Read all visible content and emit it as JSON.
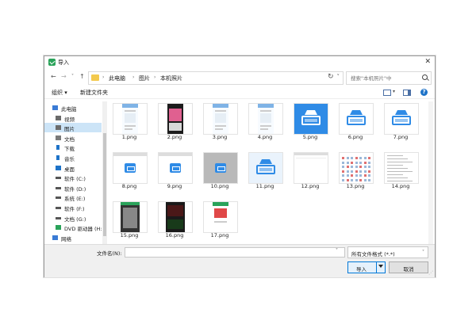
{
  "dialog": {
    "title": "导入",
    "close_glyph": "✕"
  },
  "nav": {
    "back_glyph": "←",
    "forward_glyph": "→",
    "recent_glyph": "˅",
    "up_glyph": "↑",
    "breadcrumb": [
      "此电脑",
      "图片",
      "本机照片"
    ],
    "crumb_sep": "›",
    "address_dropdown_glyph": "˅",
    "refresh_glyph": "↻",
    "search_placeholder": "搜索\"本机照片\"中"
  },
  "toolbar": {
    "organize_label": "组织 ▾",
    "new_folder_label": "新建文件夹",
    "view_dropdown_glyph": "▾",
    "help_glyph": "?"
  },
  "sidebar": {
    "items": [
      {
        "label": "此电脑",
        "icon": "pc-icon",
        "selected": false
      },
      {
        "label": "视频",
        "icon": "video-icon",
        "selected": false
      },
      {
        "label": "图片",
        "icon": "pictures-icon",
        "selected": true
      },
      {
        "label": "文档",
        "icon": "document-icon",
        "selected": false
      },
      {
        "label": "下载",
        "icon": "download-icon",
        "selected": false
      },
      {
        "label": "音乐",
        "icon": "music-icon",
        "selected": false
      },
      {
        "label": "桌面",
        "icon": "desktop-icon",
        "selected": false
      },
      {
        "label": "软件 (C:)",
        "icon": "drive-icon",
        "selected": false
      },
      {
        "label": "软件 (D:)",
        "icon": "drive-icon",
        "selected": false
      },
      {
        "label": "系统 (E:)",
        "icon": "drive-icon",
        "selected": false
      },
      {
        "label": "软件 (F:)",
        "icon": "drive-icon",
        "selected": false
      },
      {
        "label": "文档 (G:)",
        "icon": "drive-icon",
        "selected": false
      },
      {
        "label": "DVD 驱动器 (H:)",
        "icon": "dvd-icon",
        "selected": false
      },
      {
        "label": "网络",
        "icon": "network-icon",
        "selected": false
      }
    ]
  },
  "files": [
    {
      "name": "1.png",
      "kind": "phone-app"
    },
    {
      "name": "2.png",
      "kind": "phone-photo"
    },
    {
      "name": "3.png",
      "kind": "phone-app"
    },
    {
      "name": "4.png",
      "kind": "phone-app"
    },
    {
      "name": "5.png",
      "kind": "scanner-blue"
    },
    {
      "name": "6.png",
      "kind": "scanner-white"
    },
    {
      "name": "7.png",
      "kind": "scanner-white"
    },
    {
      "name": "8.png",
      "kind": "window-scanner"
    },
    {
      "name": "9.png",
      "kind": "window-scanner"
    },
    {
      "name": "10.png",
      "kind": "gray-scanner"
    },
    {
      "name": "11.png",
      "kind": "scanner-wide"
    },
    {
      "name": "12.png",
      "kind": "blank-doc"
    },
    {
      "name": "13.png",
      "kind": "grid-doc"
    },
    {
      "name": "14.png",
      "kind": "list-doc"
    },
    {
      "name": "15.png",
      "kind": "phone-dark"
    },
    {
      "name": "16.png",
      "kind": "phone-darkred"
    },
    {
      "name": "17.png",
      "kind": "phone-red"
    }
  ],
  "bottom": {
    "filename_label": "文件名(N):",
    "filename_value": "",
    "dropdown_glyph": "˅",
    "filetype_value": "所有文件格式 (*.*)",
    "open_label": "导入",
    "cancel_label": "取消"
  },
  "colors": {
    "accent": "#0078d7",
    "selected_bg": "#cce4f7",
    "app_blue": "#2f8be6",
    "folder_yellow": "#f3c94d"
  }
}
